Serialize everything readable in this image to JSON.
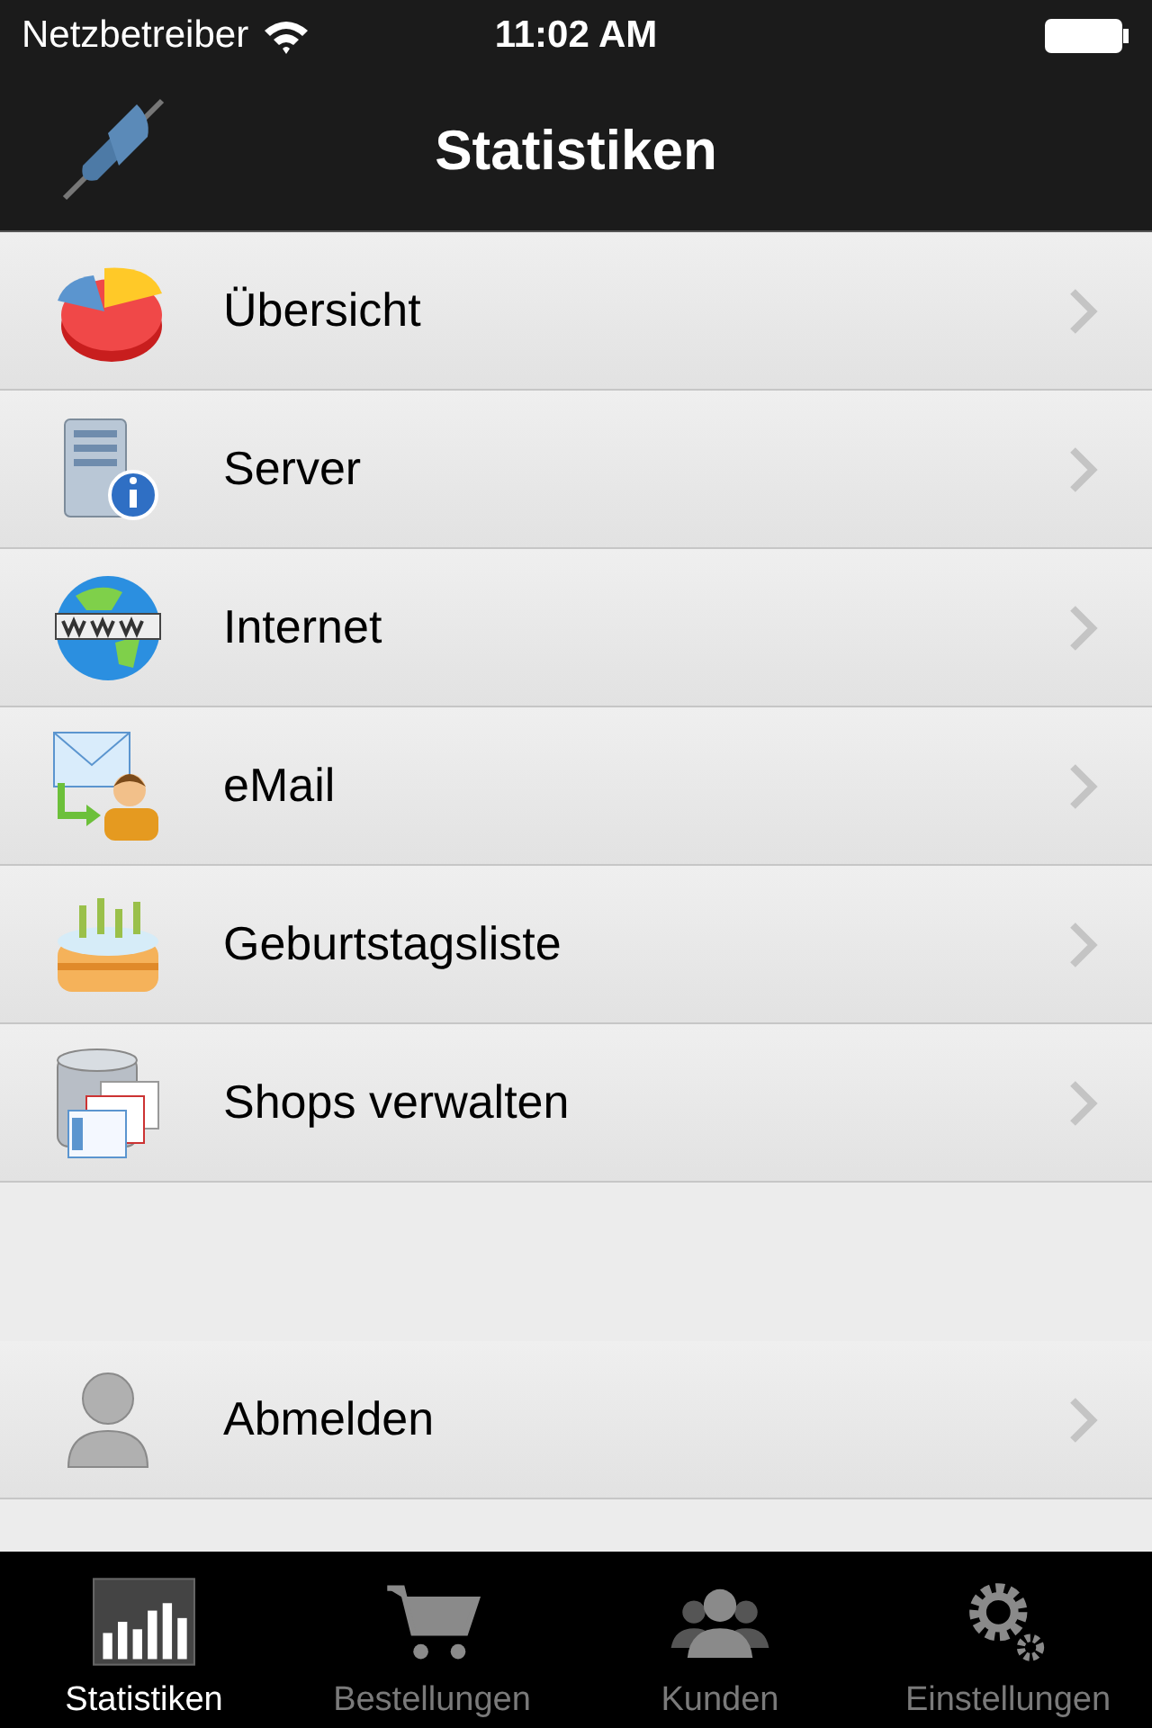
{
  "status_bar": {
    "carrier": "Netzbetreiber",
    "time": "11:02 AM"
  },
  "nav_bar": {
    "title": "Statistiken"
  },
  "sections": [
    {
      "items": [
        {
          "label": "Übersicht",
          "kind": "pie"
        },
        {
          "label": "Server",
          "kind": "server"
        },
        {
          "label": "Internet",
          "kind": "globe"
        },
        {
          "label": "eMail",
          "kind": "mail"
        },
        {
          "label": "Geburtstagsliste",
          "kind": "cake"
        },
        {
          "label": "Shops verwalten",
          "kind": "database"
        }
      ]
    },
    {
      "items": [
        {
          "label": "Abmelden",
          "kind": "user"
        }
      ]
    }
  ],
  "tab_bar": [
    {
      "label": "Statistiken",
      "kind": "chart",
      "selected": true
    },
    {
      "label": "Bestellungen",
      "kind": "cart",
      "selected": false
    },
    {
      "label": "Kunden",
      "kind": "people",
      "selected": false
    },
    {
      "label": "Einstellungen",
      "kind": "gears",
      "selected": false
    }
  ]
}
